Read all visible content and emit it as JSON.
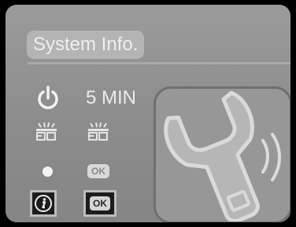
{
  "header": {
    "title": "System Info."
  },
  "settings": {
    "timeout": {
      "icon": "power-icon",
      "value": "5 MIN"
    },
    "gauges": [
      {
        "icon": "gauge-icon"
      },
      {
        "icon": "gauge-icon"
      }
    ],
    "status": {
      "dot_icon": "dot-icon",
      "ok_label": "OK"
    }
  },
  "softkeys": {
    "info": {
      "icon": "info-icon"
    },
    "ok": {
      "label": "OK"
    }
  },
  "tile": {
    "icon": "wrench-wireless-icon"
  },
  "colors": {
    "screen_top": "#9b9b9b",
    "screen_bottom": "#858585",
    "title_pill": "#b4b4b4",
    "text": "#ececec",
    "button_border": "#bdbdbd",
    "button_fill": "#1c1c1c"
  }
}
